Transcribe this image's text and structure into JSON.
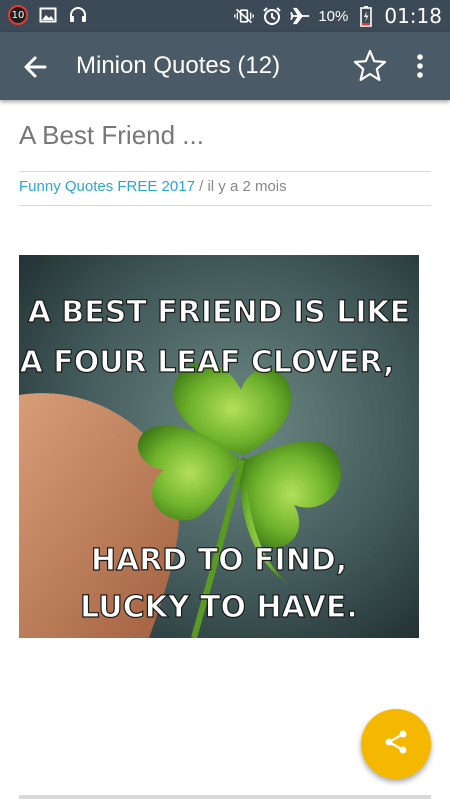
{
  "status_bar": {
    "notification_count": "10",
    "battery_percent": "10%",
    "time": "01:18",
    "icons": [
      "notification-count-badge",
      "image-icon",
      "headphones-icon",
      "vibrate-icon",
      "alarm-icon",
      "airplane-icon",
      "battery-charging-icon"
    ]
  },
  "app_bar": {
    "title": "Minion Quotes (12)",
    "icons": [
      "back-arrow-icon",
      "star-outline-icon",
      "more-vert-icon"
    ]
  },
  "post": {
    "title": "A Best Friend ...",
    "category": "Funny Quotes FREE 2017",
    "separator": " / ",
    "time_ago": "il y a 2 mois",
    "image": {
      "line1": "A BEST FRIEND IS LIKE",
      "line2": "A FOUR LEAF CLOVER,",
      "line3": "HARD TO FIND,",
      "line4": "LUCKY TO HAVE."
    }
  },
  "fab": {
    "icon": "share-icon"
  },
  "colors": {
    "status_bar": "#3b4a56",
    "app_bar": "#4a5a66",
    "link": "#29a7d4",
    "fab": "#f5b800"
  }
}
